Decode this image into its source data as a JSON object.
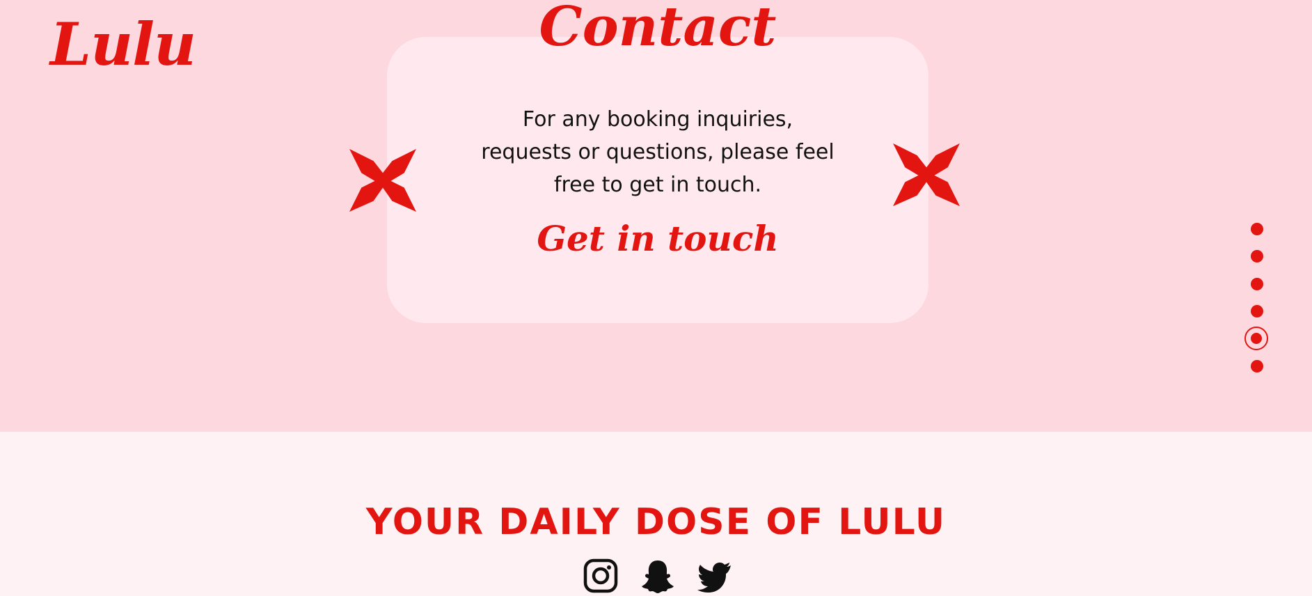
{
  "brand": {
    "logo": "Lulu",
    "accent_color": "#e31510",
    "background_top": "#fed8df",
    "background_bottom": "#fff2f5",
    "card_color": "#ffe9ef"
  },
  "contact": {
    "title": "Contact",
    "text_line1": "For any booking inquiries,",
    "text_line2": "requests or questions, please feel",
    "text_line3": "free to get in touch.",
    "cta": "Get in touch"
  },
  "decorations": {
    "left_icon": "red-star-icon",
    "right_icon": "red-star-icon"
  },
  "section_nav": {
    "count": 6,
    "active_index": 4
  },
  "footer": {
    "title": "YOUR DAILY DOSE OF LULU",
    "social_icons": [
      "instagram-icon",
      "snapchat-icon",
      "twitter-icon"
    ]
  }
}
